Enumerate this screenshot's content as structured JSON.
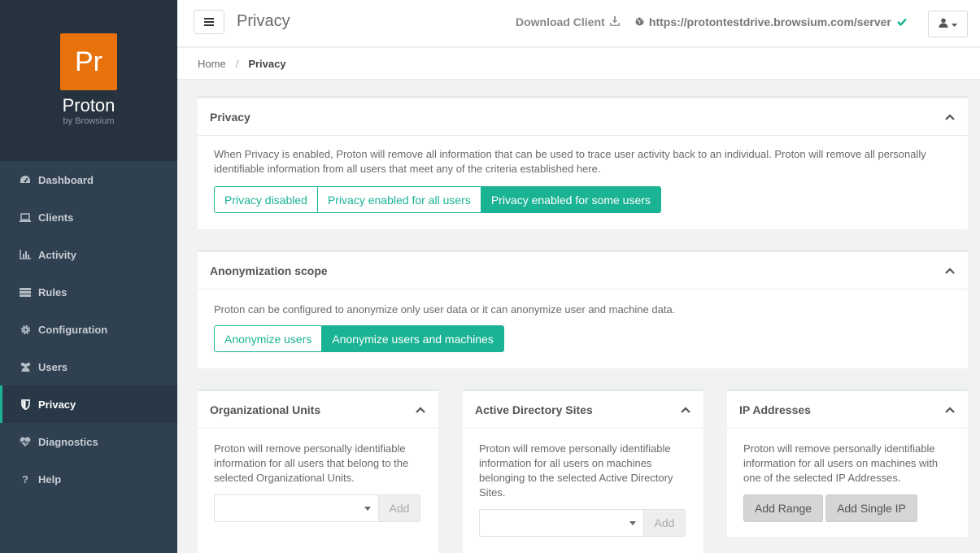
{
  "brand": {
    "logo_text": "Pr",
    "name": "Proton",
    "sub": "by Browsium",
    "logo_color": "#e8720c"
  },
  "sidebar": {
    "items": [
      {
        "label": "Dashboard",
        "icon": "dashboard-icon"
      },
      {
        "label": "Clients",
        "icon": "laptop-icon"
      },
      {
        "label": "Activity",
        "icon": "bar-chart-icon"
      },
      {
        "label": "Rules",
        "icon": "list-icon"
      },
      {
        "label": "Configuration",
        "icon": "gear-icon"
      },
      {
        "label": "Users",
        "icon": "users-icon"
      },
      {
        "label": "Privacy",
        "icon": "shield-icon",
        "active": true
      },
      {
        "label": "Diagnostics",
        "icon": "heartbeat-icon"
      },
      {
        "label": "Help",
        "icon": "question-icon"
      }
    ]
  },
  "topbar": {
    "title": "Privacy",
    "download": "Download Client",
    "server_url": "https://protontestdrive.browsium.com/server"
  },
  "breadcrumb": {
    "home": "Home",
    "current": "Privacy"
  },
  "privacy_panel": {
    "title": "Privacy",
    "description": "When Privacy is enabled, Proton will remove all information that can be used to trace user activity back to an individual. Proton will remove all personally identifiable information from all users that meet any of the criteria established here.",
    "options": [
      "Privacy disabled",
      "Privacy enabled for all users",
      "Privacy enabled for some users"
    ],
    "selected": "Privacy enabled for some users"
  },
  "scope_panel": {
    "title": "Anonymization scope",
    "description": "Proton can be configured to anonymize only user data or it can anonymize user and machine data.",
    "options": [
      "Anonymize users",
      "Anonymize users and machines"
    ],
    "selected": "Anonymize users and machines"
  },
  "ou_panel": {
    "title": "Organizational Units",
    "description": "Proton will remove personally identifiable information for all users that belong to the selected Organizational Units.",
    "add_label": "Add"
  },
  "ad_panel": {
    "title": "Active Directory Sites",
    "description": "Proton will remove personally identifiable information for all users on machines belonging to the selected Active Directory Sites.",
    "add_label": "Add"
  },
  "ip_panel": {
    "title": "IP Addresses",
    "description": "Proton will remove personally identifiable information for all users on machines with one of the selected IP Addresses.",
    "add_range_label": "Add Range",
    "add_single_label": "Add Single IP"
  },
  "colors": {
    "accent": "#1ab394",
    "sidebar_bg": "#2f4050",
    "brand_bg": "#26333f"
  }
}
